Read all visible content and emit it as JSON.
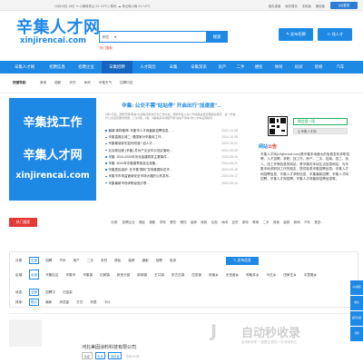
{
  "topbar": {
    "date_weather": "10月13日 13日 ☀ 小雨转多云 21~12°C | 周天: ☁ 多云转小雨 21~12°C",
    "links": [
      "保存桌面",
      "保存首页",
      "手机版",
      "微信版"
    ],
    "qq_button": "QQ登录"
  },
  "header": {
    "logo_title": "辛集人才网",
    "logo_sub": "xinjirencai.com",
    "search_type": "职位",
    "search_placeholder": "",
    "search_button": "搜索",
    "hot_words": "热门搜索:",
    "post_job_button": "发布招聘",
    "find_person_button": "找人才"
  },
  "nav": {
    "items": [
      "辛集人才网",
      "招聘信息",
      "招聘企业",
      "辛集招聘",
      "人才简历",
      "辛集",
      "辛集资讯",
      "房产",
      "二手",
      "便民",
      "休闲",
      "培训",
      "装修",
      "汽车"
    ],
    "active_index": 3
  },
  "quick_nav": {
    "label": "快捷导航:",
    "items": [
      "美食",
      "摄影",
      "农村",
      "休闲",
      "辛集天气",
      "招聘问答"
    ]
  },
  "banner": {
    "line1": "辛集找工作",
    "line2": "辛集人才网",
    "line3": "xinjirencai.com"
  },
  "news": {
    "headline": "辛集: 公交不需\"站站停\" 开启出行\"加速度\"...",
    "summary": "9月4日起，按照开展\"两进\"交通秩序整治行动工作方案，按照辛集公交公司线路运营管理相关规定，进一步提升公交运营服务质量，公交1路、2路、5路等多条线路开通\"站站不停车\"的公交车运营模式...",
    "items": [
      {
        "title": "最新!事物推荐! 辛集市人才网最新招聘信息，...",
        "date": "2024-10-08"
      },
      {
        "title": "辛集直推区域二: 看国家对辛集用工环...",
        "date": "2024-10-05"
      },
      {
        "title": "辛集都城老宅如何改造? 招人才...",
        "date": "2024-10-01"
      },
      {
        "title": "北京新加坡 (辛集) 苏州产业合作示范区落地...",
        "date": "2024-09-26"
      },
      {
        "title": "辛集: 2024-2025年河北省建筑类主要事件...",
        "date": "2024-09-24"
      },
      {
        "title": "辛集: 2024年辛集春季旅游业准备...",
        "date": "2024-09-21"
      },
      {
        "title": "辛集居民组织: 在辛集\"顺利\"花场象国际花卉...",
        "date": "2024-09-19"
      },
      {
        "title": "辛集市市场监管局安全市场大福的公布发布...",
        "date": "2024-09-17"
      },
      {
        "title": "辛集最新市场求职经验分享...",
        "date": "2024-09-14"
      }
    ]
  },
  "side": {
    "weixin_tag": "微信搜一搜",
    "weixin_button": "Q 辛集人才网",
    "notice_title_blue": "网站",
    "notice_title_red": "公告",
    "notice_body": "辛集人才网(xinjirencai.com)是辛集本地最大的免费发布求职招聘、人才招聘、求职、找工作、房产、二手、招商、招工、找人、找工作等信息的网站，是辛集的本地生活信息网站，为辛集本地求职找工作的朋友，提供各类辛集招聘信息、辛集人才网招聘信息、辛集人才求职信息、辛集最新招聘，辛集人才网招聘，辛集人才网招聘，辛集人才网最新招聘信息等。"
  },
  "hot_tabs": {
    "tab": "热门搜索",
    "items": [
      "分类:",
      "招聘企业",
      "便民",
      "摄影",
      "学校",
      "餐饮",
      "餐饮",
      "装修",
      "家政",
      "住宿",
      "休闲",
      "百货",
      "家电",
      "教育",
      "二手",
      "美食",
      "装修",
      "新网",
      "汽车",
      "更多..."
    ]
  },
  "filters": {
    "publish_button": "发布信息",
    "rows": [
      {
        "key": "分类:",
        "options": [
          "全部",
          "招聘",
          "汽车",
          "房产",
          "二手",
          "农村",
          "便民",
          "装修",
          "摄影",
          "招聘",
          "培训"
        ],
        "selected": 0
      },
      {
        "key": "区域:",
        "options": [
          "全部",
          "辛集区区",
          "辛集市",
          "辛集镇",
          "旧城镇",
          "新垒头镇",
          "新城镇",
          "王口镇",
          "张古庄镇",
          "位伯镇",
          "前营乡",
          "天宫营乡",
          "和睦井乡",
          "马庄乡",
          "田家庄乡",
          "中里厢乡"
        ],
        "selected": 0
      },
      {
        "key": "状态:",
        "options": [
          "全部",
          "招聘中",
          "已结束"
        ],
        "selected": 0
      },
      {
        "key": "排序:",
        "options": [
          "默认",
          "最新",
          "浏览量",
          "方式",
          "列表",
          "卡片"
        ],
        "selected": 0
      }
    ]
  },
  "job": {
    "company": "河北美固涂料科技有限公司",
    "tags": [
      "认证",
      "实名",
      "保证金"
    ],
    "time": "今天13:33"
  },
  "float_bar": [
    "QQ客服",
    "微信",
    "返回顶部",
    "顶部"
  ],
  "watermark": {
    "mark": "J",
    "title": "自动秒收录",
    "subtitle": "自动秒收录·一键提交·发布一次·收录到位"
  }
}
